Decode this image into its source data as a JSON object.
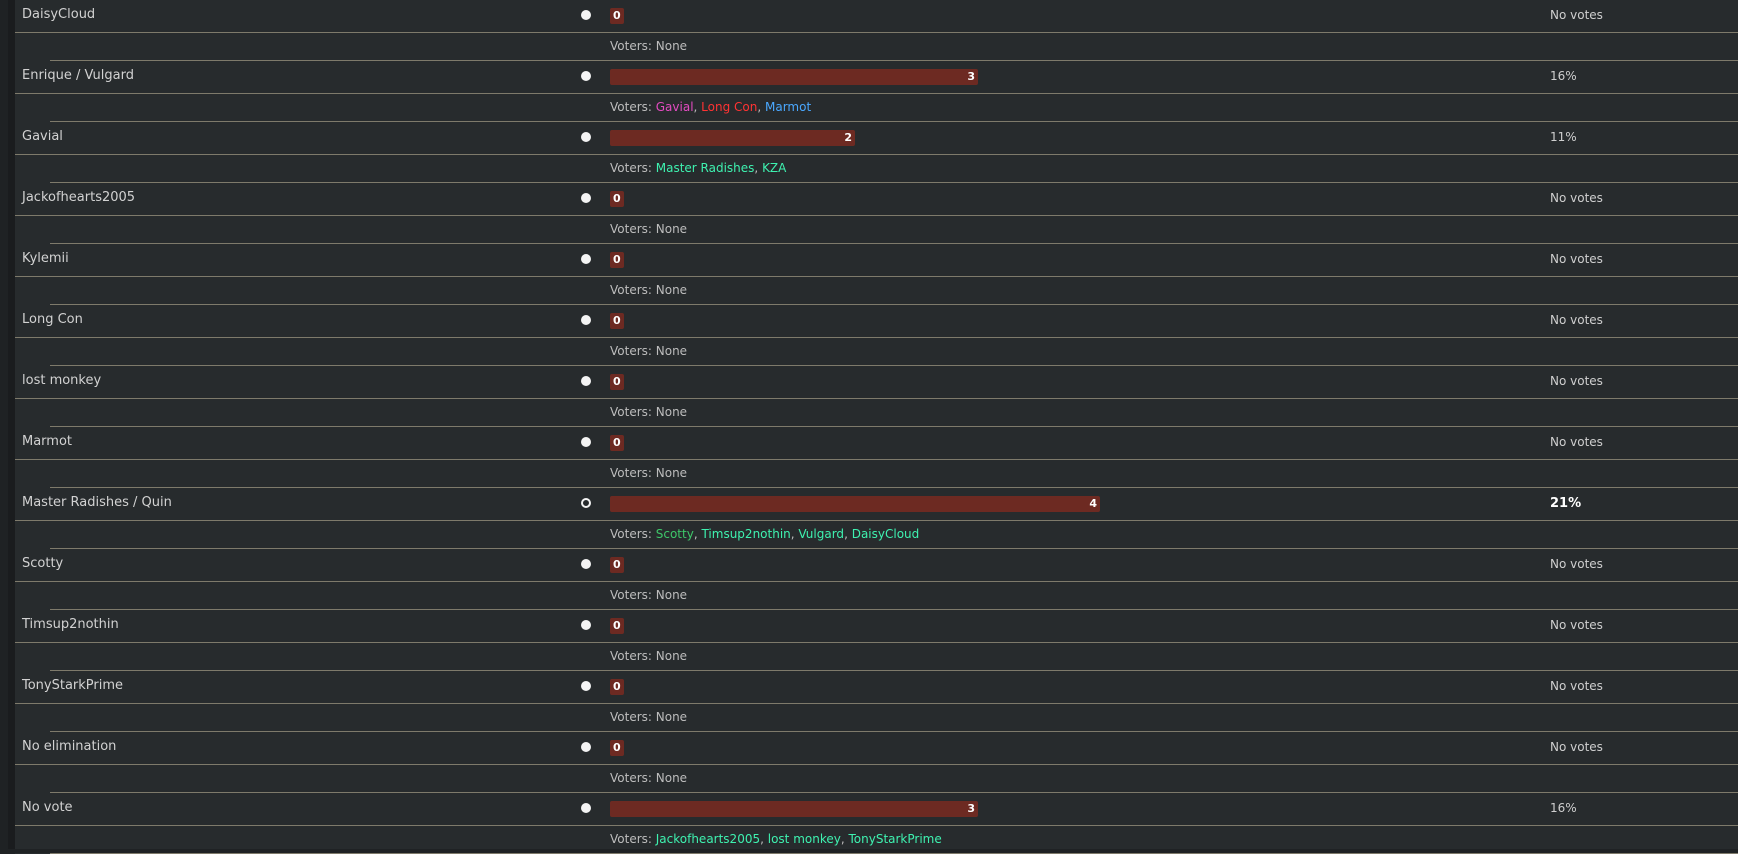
{
  "voters_prefix": "Voters:",
  "options": [
    {
      "name": "DaisyCloud",
      "votes": 0,
      "bar_fraction": 0,
      "percent_label": "No votes",
      "highlight": false,
      "selected": false,
      "none_label": "None",
      "voters": []
    },
    {
      "name": "Enrique / Vulgard",
      "votes": 3,
      "bar_fraction": 0.75,
      "percent_label": "16%",
      "highlight": false,
      "selected": false,
      "none_label": "",
      "voters": [
        {
          "name": "Gavial",
          "color": "#e34bc1"
        },
        {
          "name": "Long Con",
          "color": "#ff3333"
        },
        {
          "name": "Marmot",
          "color": "#4aa8ff"
        }
      ]
    },
    {
      "name": "Gavial",
      "votes": 2,
      "bar_fraction": 0.5,
      "percent_label": "11%",
      "highlight": false,
      "selected": false,
      "none_label": "",
      "voters": [
        {
          "name": "Master Radishes",
          "color": "#3ef2b0"
        },
        {
          "name": "KZA",
          "color": "#3ef2b0"
        }
      ]
    },
    {
      "name": "Jackofhearts2005",
      "votes": 0,
      "bar_fraction": 0,
      "percent_label": "No votes",
      "highlight": false,
      "selected": false,
      "none_label": "None",
      "voters": []
    },
    {
      "name": "Kylemii",
      "votes": 0,
      "bar_fraction": 0,
      "percent_label": "No votes",
      "highlight": false,
      "selected": false,
      "none_label": "None",
      "voters": []
    },
    {
      "name": "Long Con",
      "votes": 0,
      "bar_fraction": 0,
      "percent_label": "No votes",
      "highlight": false,
      "selected": false,
      "none_label": "None",
      "voters": []
    },
    {
      "name": "lost monkey",
      "votes": 0,
      "bar_fraction": 0,
      "percent_label": "No votes",
      "highlight": false,
      "selected": false,
      "none_label": "None",
      "voters": []
    },
    {
      "name": "Marmot",
      "votes": 0,
      "bar_fraction": 0,
      "percent_label": "No votes",
      "highlight": false,
      "selected": false,
      "none_label": "None",
      "voters": []
    },
    {
      "name": "Master Radishes / Quin",
      "votes": 4,
      "bar_fraction": 1.0,
      "percent_label": "21%",
      "highlight": true,
      "selected": true,
      "none_label": "",
      "voters": [
        {
          "name": "Scotty",
          "color": "#3ec86a"
        },
        {
          "name": "Timsup2nothin",
          "color": "#3ef2b0"
        },
        {
          "name": "Vulgard",
          "color": "#3ef2b0"
        },
        {
          "name": "DaisyCloud",
          "color": "#3ef2b0"
        }
      ]
    },
    {
      "name": "Scotty",
      "votes": 0,
      "bar_fraction": 0,
      "percent_label": "No votes",
      "highlight": false,
      "selected": false,
      "none_label": "None",
      "voters": []
    },
    {
      "name": "Timsup2nothin",
      "votes": 0,
      "bar_fraction": 0,
      "percent_label": "No votes",
      "highlight": false,
      "selected": false,
      "none_label": "None",
      "voters": []
    },
    {
      "name": "TonyStarkPrime",
      "votes": 0,
      "bar_fraction": 0,
      "percent_label": "No votes",
      "highlight": false,
      "selected": false,
      "none_label": "None",
      "voters": []
    },
    {
      "name": "No elimination",
      "votes": 0,
      "bar_fraction": 0,
      "percent_label": "No votes",
      "highlight": false,
      "selected": false,
      "none_label": "None",
      "voters": []
    },
    {
      "name": "No vote",
      "votes": 3,
      "bar_fraction": 0.75,
      "percent_label": "16%",
      "highlight": false,
      "selected": false,
      "none_label": "",
      "voters": [
        {
          "name": "Jackofhearts2005",
          "color": "#3ef2b0"
        },
        {
          "name": "lost monkey",
          "color": "#3ef2b0"
        },
        {
          "name": "TonyStarkPrime",
          "color": "#3ef2b0"
        }
      ]
    }
  ]
}
